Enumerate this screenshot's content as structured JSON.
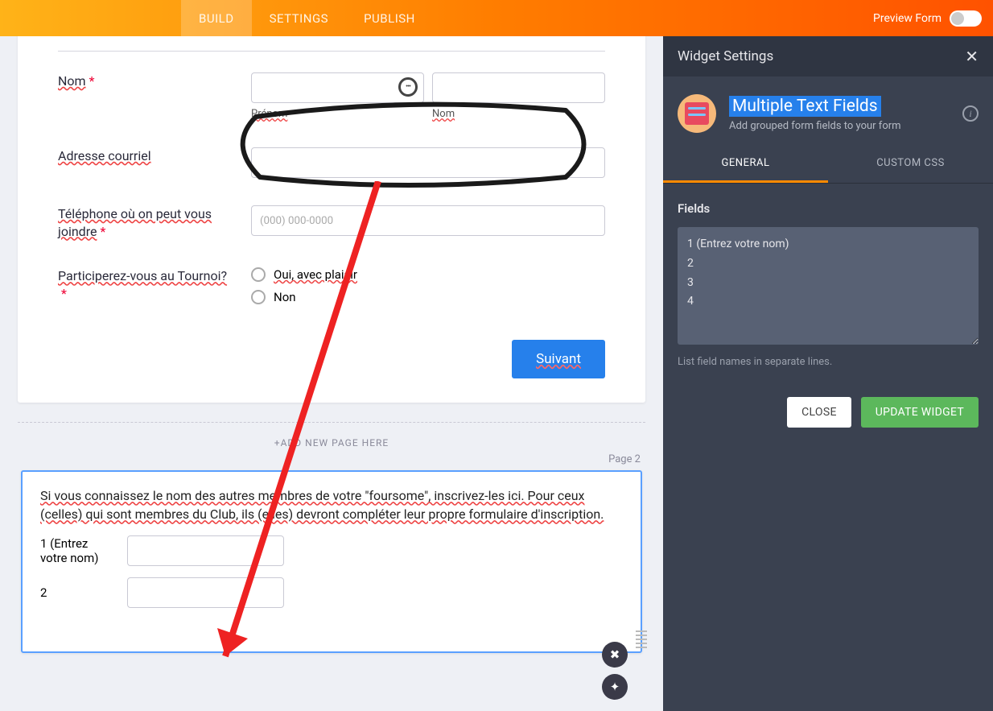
{
  "topbar": {
    "tabs": [
      "BUILD",
      "SETTINGS",
      "PUBLISH"
    ],
    "active": 0,
    "preview_label": "Preview Form"
  },
  "form": {
    "name_label": "Nom",
    "first_sub": "Prénom",
    "last_sub": "Nom",
    "email_label": "Adresse courriel",
    "phone_label_1": "Téléphone où on peut vous",
    "phone_label_2": "joindre",
    "phone_placeholder": "(000) 000-0000",
    "participate_label": "Participerez-vous au Tournoi?",
    "opt_yes": "Oui, avec plaisir",
    "opt_no": "Non",
    "next": "Suivant",
    "add_page": "+ADD NEW PAGE HERE",
    "page2": "Page 2",
    "foursome_text": "Si vous connaissez le nom des autres membres de votre \"foursome\", inscrivez-les ici.  Pour ceux (celles) qui sont membres du Club, ils (elles) devront compléter leur propre formulaire d'inscription.",
    "w1": "1 (Entrez votre nom)",
    "w2": "2"
  },
  "sidebar": {
    "title": "Widget Settings",
    "widget_name": "Multiple Text Fields",
    "widget_desc": "Add grouped form fields to your form",
    "tab_general": "GENERAL",
    "tab_css": "CUSTOM CSS",
    "fields_label": "Fields",
    "fields_value": "1 (Entrez votre nom)\n2\n3\n4",
    "fields_help": "List field names in separate lines.",
    "close": "CLOSE",
    "update": "UPDATE WIDGET"
  }
}
